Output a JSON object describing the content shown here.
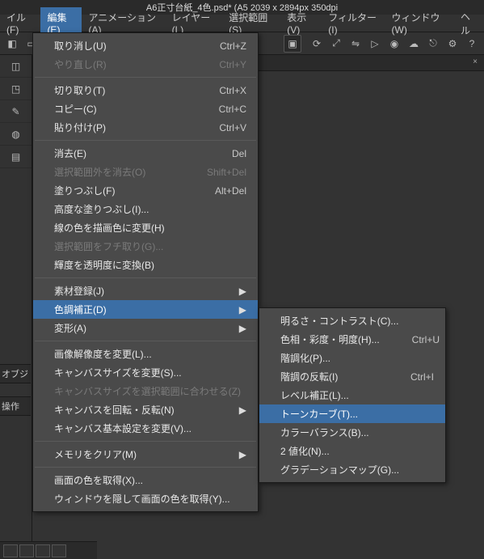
{
  "titlebar": "A6正寸台紙_4色.psd* (A5 2039 x 2894px 350dpi",
  "menubar": [
    {
      "label": "イル(F)"
    },
    {
      "label": "編集(E)",
      "active": true
    },
    {
      "label": "アニメーション(A)"
    },
    {
      "label": "レイヤー(L)"
    },
    {
      "label": "選択範囲(S)"
    },
    {
      "label": "表示(V)"
    },
    {
      "label": "フィルター(I)"
    },
    {
      "label": "ウィンドウ(W)"
    },
    {
      "label": "ヘル"
    }
  ],
  "dock": {
    "label1": "オブジ",
    "label2": "操作"
  },
  "edit_menu": [
    {
      "label": "取り消し(U)",
      "shortcut": "Ctrl+Z"
    },
    {
      "label": "やり直し(R)",
      "shortcut": "Ctrl+Y",
      "disabled": true
    },
    {
      "sep": true
    },
    {
      "label": "切り取り(T)",
      "shortcut": "Ctrl+X"
    },
    {
      "label": "コピー(C)",
      "shortcut": "Ctrl+C"
    },
    {
      "label": "貼り付け(P)",
      "shortcut": "Ctrl+V"
    },
    {
      "sep": true
    },
    {
      "label": "消去(E)",
      "shortcut": "Del"
    },
    {
      "label": "選択範囲外を消去(O)",
      "shortcut": "Shift+Del",
      "disabled": true
    },
    {
      "label": "塗りつぶし(F)",
      "shortcut": "Alt+Del"
    },
    {
      "label": "高度な塗りつぶし(I)..."
    },
    {
      "label": "線の色を描画色に変更(H)"
    },
    {
      "label": "選択範囲をフチ取り(G)...",
      "disabled": true
    },
    {
      "label": "輝度を透明度に変換(B)"
    },
    {
      "sep": true
    },
    {
      "label": "素材登録(J)",
      "submenu": true
    },
    {
      "label": "色調補正(D)",
      "submenu": true,
      "highlight": true
    },
    {
      "label": "変形(A)",
      "submenu": true
    },
    {
      "sep": true
    },
    {
      "label": "画像解像度を変更(L)..."
    },
    {
      "label": "キャンバスサイズを変更(S)..."
    },
    {
      "label": "キャンバスサイズを選択範囲に合わせる(Z)",
      "disabled": true
    },
    {
      "label": "キャンバスを回転・反転(N)",
      "submenu": true
    },
    {
      "label": "キャンバス基本設定を変更(V)..."
    },
    {
      "sep": true
    },
    {
      "label": "メモリをクリア(M)",
      "submenu": true
    },
    {
      "sep": true
    },
    {
      "label": "画面の色を取得(X)..."
    },
    {
      "label": "ウィンドウを隠して画面の色を取得(Y)..."
    }
  ],
  "sub_menu": [
    {
      "label": "明るさ・コントラスト(C)..."
    },
    {
      "label": "色相・彩度・明度(H)...",
      "shortcut": "Ctrl+U"
    },
    {
      "label": "階調化(P)..."
    },
    {
      "label": "階調の反転(I)",
      "shortcut": "Ctrl+I"
    },
    {
      "label": "レベル補正(L)..."
    },
    {
      "label": "トーンカーブ(T)...",
      "highlight": true
    },
    {
      "label": "カラーバランス(B)..."
    },
    {
      "label": "2 値化(N)..."
    },
    {
      "label": "グラデーションマップ(G)..."
    }
  ]
}
